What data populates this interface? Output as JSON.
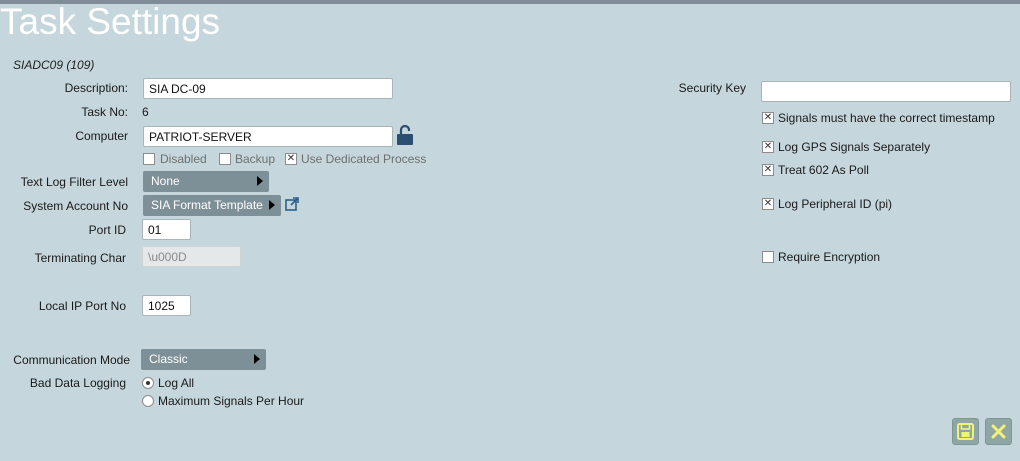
{
  "header": {
    "title": "Task Settings",
    "subtitle": "SIADC09 (109)"
  },
  "form": {
    "description": {
      "label": "Description:",
      "value": "SIA DC-09"
    },
    "task_no": {
      "label": "Task No:",
      "value": "6"
    },
    "computer": {
      "label": "Computer",
      "value": "PATRIOT-SERVER"
    },
    "options": {
      "disabled": {
        "label": "Disabled",
        "checked": false
      },
      "backup": {
        "label": "Backup",
        "checked": false
      },
      "dedicated": {
        "label": "Use Dedicated Process",
        "checked": true
      }
    },
    "text_log": {
      "label": "Text Log Filter Level",
      "value": "None"
    },
    "system_account": {
      "label": "System Account No",
      "value": "SIA Format Template"
    },
    "port_id": {
      "label": "Port ID",
      "value": "01"
    },
    "terminating_char": {
      "label": "Terminating Char",
      "value": "\\u000D"
    },
    "local_ip_port": {
      "label": "Local IP Port No",
      "value": "1025"
    },
    "comm_mode": {
      "label": "Communication Mode",
      "value": "Classic"
    },
    "bad_data": {
      "label": "Bad Data Logging",
      "options": [
        "Log All",
        "Maximum Signals Per Hour"
      ],
      "selected": "Log All"
    }
  },
  "right": {
    "security_key": {
      "label": "Security Key",
      "value": ""
    },
    "signals_timestamp": {
      "label": "Signals must have the correct timestamp",
      "checked": true
    },
    "log_gps": {
      "label": "Log GPS Signals Separately",
      "checked": true
    },
    "treat_602": {
      "label": "Treat 602 As Poll",
      "checked": true
    },
    "log_peripheral": {
      "label": "Log Peripheral ID (pi)",
      "checked": true
    },
    "require_encryption": {
      "label": "Require Encryption",
      "checked": false
    }
  },
  "check_glyph": "✕",
  "colors": {
    "background": "#c5d6dc",
    "dropdown": "#7e9097",
    "action_button": "#8fa6a4",
    "action_icon": "#f2f27a"
  }
}
